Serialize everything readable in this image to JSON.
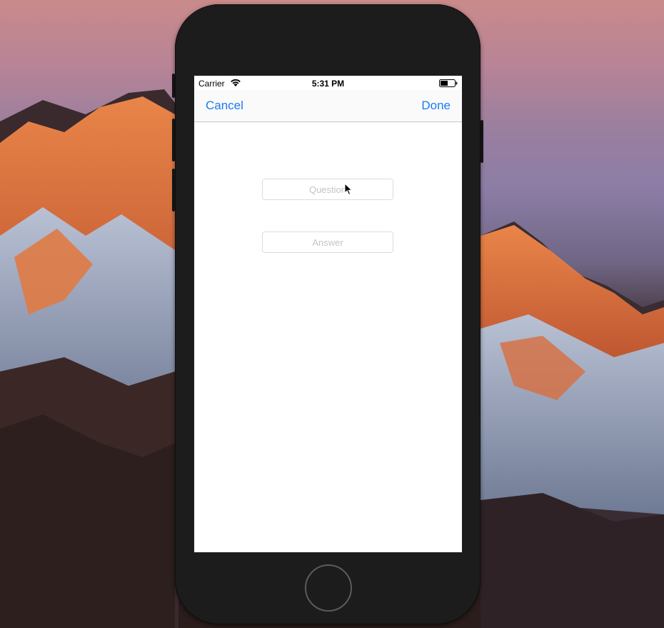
{
  "status_bar": {
    "carrier": "Carrier",
    "time": "5:31 PM",
    "wifi_icon": "wifi-icon",
    "battery_icon": "battery-icon"
  },
  "nav_bar": {
    "cancel_label": "Cancel",
    "done_label": "Done"
  },
  "form": {
    "question": {
      "value": "",
      "placeholder": "Question"
    },
    "answer": {
      "value": "",
      "placeholder": "Answer"
    }
  },
  "colors": {
    "accent": "#1a7cf2",
    "device_body": "#1c1c1d",
    "placeholder": "#c4c4c6"
  }
}
